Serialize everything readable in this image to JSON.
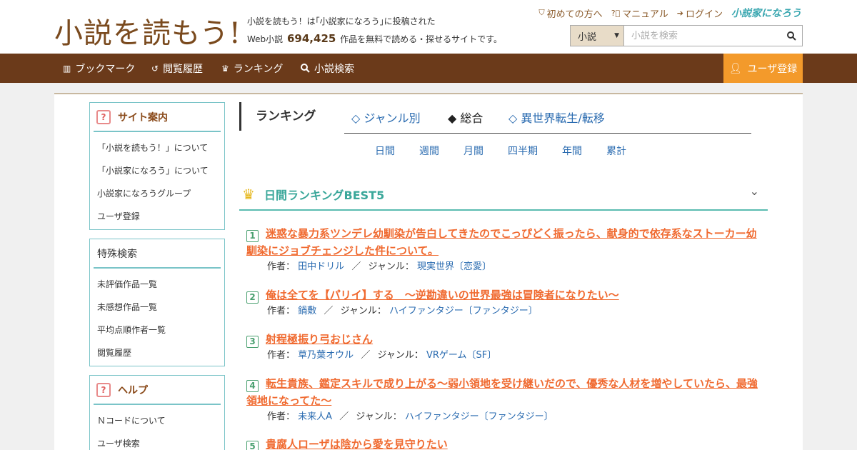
{
  "site": {
    "logo_text": "小説を読もう!",
    "tagline_line1": "小説を読もう！は｢小説家になろう｣に投稿された",
    "tagline_prefix": "Web小説",
    "tagline_count": "694,425",
    "tagline_suffix": "作品を無料で読める・探せるサイトです。"
  },
  "toplinks": {
    "beginner": "初めての方へ",
    "manual": "マニュアル",
    "login": "ログイン",
    "narou": "小説家になろう"
  },
  "search": {
    "select_value": "小説",
    "placeholder": "小説を検索"
  },
  "nav": {
    "bookmark": "ブックマーク",
    "history": "閲覧履歴",
    "ranking": "ランキング",
    "search": "小説検索",
    "register": "ユーザ登録"
  },
  "sidebar": {
    "site_guide": {
      "title": "サイト案内",
      "items": [
        "「小説を読もう！」について",
        "「小説家になろう」について",
        "小説家になろうグループ",
        "ユーザ登録"
      ]
    },
    "special_search": {
      "title": "特殊検索",
      "items": [
        "未評価作品一覧",
        "未感想作品一覧",
        "平均点順作者一覧",
        "閲覧履歴"
      ]
    },
    "help": {
      "title": "ヘルプ",
      "items": [
        "Ｎコードについて",
        "ユーザ検索"
      ]
    }
  },
  "ranking": {
    "heading": "ランキング",
    "tabs": [
      "◇ ジャンル別",
      "◆ 総合",
      "◇ 異世界転生/転移"
    ],
    "periods": [
      "日間",
      "週間",
      "月間",
      "四半期",
      "年間",
      "累計"
    ],
    "best_title": "日間ランキングBEST5",
    "author_label": "作者：",
    "genre_label": "ジャンル：",
    "separator": "／",
    "items": [
      {
        "rank": "1",
        "title": "迷惑な暴力系ツンデレ幼馴染が告白してきたのでこっぴどく振ったら、献身的で依存系なストーカー幼馴染にジョブチェンジした件について。",
        "author": "田中ドリル",
        "genre": "現実世界〔恋愛〕"
      },
      {
        "rank": "2",
        "title": "俺は全てを【パリイ】する　〜逆勘違いの世界最強は冒険者になりたい〜",
        "author": "鍋敷",
        "genre": "ハイファンタジー〔ファンタジー〕"
      },
      {
        "rank": "3",
        "title": "射程極振り弓おじさん",
        "author": "草乃葉オウル",
        "genre": "VRゲーム〔SF〕"
      },
      {
        "rank": "4",
        "title": "転生貴族、鑑定スキルで成り上がる～弱小領地を受け継いだので、優秀な人材を増やしていたら、最強領地になってた～",
        "author": "未来人A",
        "genre": "ハイファンタジー〔ファンタジー〕"
      },
      {
        "rank": "5",
        "title": "貴腐人ローザは陰から愛を見守りたい"
      }
    ]
  }
}
